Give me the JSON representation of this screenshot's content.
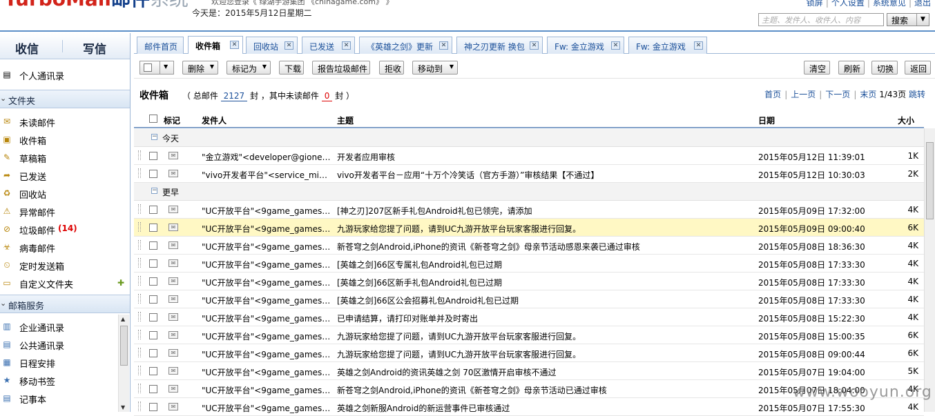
{
  "header": {
    "logo_main": "TurboMail",
    "logo_mail": "邮件",
    "logo_sys": "系统",
    "welcome": "欢迎您登录《 绿湖手游集团   《chinagame.com》 》",
    "today": "今天是：2015年5月12日星期二",
    "links": [
      "锁屏",
      "个人设置",
      "系统意见",
      "退出"
    ],
    "search_placeholder": "主题、发件人、收件人、内容",
    "search_button": "搜索"
  },
  "sidebar": {
    "tab_inbox": "收信",
    "tab_compose": "写信",
    "contacts": "个人通讯录",
    "folders_section": "文件夹",
    "folders": [
      {
        "label": "未读邮件",
        "icon": "unread-folder-icon"
      },
      {
        "label": "收件箱",
        "icon": "inbox-icon"
      },
      {
        "label": "草稿箱",
        "icon": "drafts-icon"
      },
      {
        "label": "已发送",
        "icon": "sent-icon"
      },
      {
        "label": "回收站",
        "icon": "trash-icon"
      },
      {
        "label": "异常邮件",
        "icon": "abnormal-mail-icon"
      },
      {
        "label": "垃圾邮件",
        "icon": "spam-icon"
      },
      {
        "label": "病毒邮件",
        "icon": "virus-mail-icon"
      },
      {
        "label": "定时发送箱",
        "icon": "scheduled-icon"
      },
      {
        "label": "自定义文件夹",
        "icon": "custom-folder-icon"
      }
    ],
    "spam_count": "(14)",
    "services_section": "邮箱服务",
    "services": [
      "企业通讯录",
      "公共通讯录",
      "日程安排",
      "移动书签",
      "记事本"
    ]
  },
  "tabs": [
    "邮件首页",
    "收件箱",
    "回收站",
    "已发送",
    "《英雄之剑》更新",
    "神之刃更新 换包",
    "Fw: 金立游戏",
    "Fw: 金立游戏"
  ],
  "toolbar": {
    "delete": "删除",
    "mark_as": "标记为",
    "download": "下载",
    "report_spam": "报告垃圾邮件",
    "reject": "拒收",
    "move_to": "移动到",
    "clear": "清空",
    "refresh": "刷新",
    "switch": "切换",
    "back": "返回"
  },
  "info": {
    "box_title": "收件箱",
    "total_prefix": "（ 总邮件",
    "total": "2127",
    "mid": "封 ，其中未读邮件",
    "unread": "0",
    "suffix": "封 ）",
    "pager_first": "首页",
    "pager_prev": "上一页",
    "pager_next": "下一页",
    "pager_last": "末页",
    "pager_status": "1/43页",
    "pager_jump": "跳转"
  },
  "columns": {
    "mark": "标记",
    "from": "发件人",
    "subject": "主题",
    "date": "日期",
    "size": "大小"
  },
  "groups": {
    "today": "今天",
    "earlier": "更早"
  },
  "emails_today": [
    {
      "from": "\"金立游戏\"<developer@gionee.com>",
      "subject": "开发者应用审核",
      "date": "2015年05月12日 11:39:01",
      "size": "1K"
    },
    {
      "from": "\"vivo开发者平台\"<service_mi@vivo.com>",
      "subject": "vivo开发者平台－应用“十万个冷笑话（官方手游）”审核结果【不通过】",
      "date": "2015年05月12日 10:30:03",
      "size": "2K"
    }
  ],
  "emails_earlier": [
    {
      "from": "\"UC开放平台\"<9game_gameservice@uc.cn>",
      "subject": "[神之刃]207区新手礼包Android礼包已领完，请添加",
      "date": "2015年05月09日 17:32:00",
      "size": "4K"
    },
    {
      "from": "\"UC开放平台\"<9game_gameservice@uc.cn>",
      "subject": "九游玩家给您提了问题，请到UC九游开放平台玩家客服进行回复。",
      "date": "2015年05月09日 09:00:40",
      "size": "6K"
    },
    {
      "from": "\"UC开放平台\"<9game_gameservice@uc.cn>",
      "subject": "新苍穹之剑Android,iPhone的资讯《新苍穹之剑》母亲节活动感恩来袭已通过审核",
      "date": "2015年05月08日 18:36:30",
      "size": "4K"
    },
    {
      "from": "\"UC开放平台\"<9game_gameservice@uc.cn>",
      "subject": "[英雄之剑]66区专属礼包Android礼包已过期",
      "date": "2015年05月08日 17:33:30",
      "size": "4K"
    },
    {
      "from": "\"UC开放平台\"<9game_gameservice@uc.cn>",
      "subject": "[英雄之剑]66区新手礼包Android礼包已过期",
      "date": "2015年05月08日 17:33:30",
      "size": "4K"
    },
    {
      "from": "\"UC开放平台\"<9game_gameservice@uc.cn>",
      "subject": "[英雄之剑]66区公会招募礼包Android礼包已过期",
      "date": "2015年05月08日 17:33:30",
      "size": "4K"
    },
    {
      "from": "\"UC开放平台\"<9game_gameservice@uc.cn>",
      "subject": "已申请结算，请打印对账单并及时寄出",
      "date": "2015年05月08日 15:22:30",
      "size": "4K"
    },
    {
      "from": "\"UC开放平台\"<9game_gameservice@uc.cn>",
      "subject": "九游玩家给您提了问题，请到UC九游开放平台玩家客服进行回复。",
      "date": "2015年05月08日 15:00:35",
      "size": "6K"
    },
    {
      "from": "\"UC开放平台\"<9game_gameservice@uc.cn>",
      "subject": "九游玩家给您提了问题，请到UC九游开放平台玩家客服进行回复。",
      "date": "2015年05月08日 09:00:44",
      "size": "6K"
    },
    {
      "from": "\"UC开放平台\"<9game_gameservice@uc.cn>",
      "subject": "英雄之剑Android的资讯英雄之剑 70区激情开启审核不通过",
      "date": "2015年05月07日 19:04:00",
      "size": "5K"
    },
    {
      "from": "\"UC开放平台\"<9game_gameservice@uc.cn>",
      "subject": "新苍穹之剑Android,iPhone的资讯《新苍穹之剑》母亲节活动已通过审核",
      "date": "2015年05月07日 18:04:00",
      "size": "4K"
    },
    {
      "from": "\"UC开放平台\"<9game_gameservice@uc.cn>",
      "subject": "英雄之剑新服Android的新运营事件已审核通过",
      "date": "2015年05月07日 17:55:30",
      "size": "4K"
    }
  ],
  "watermark": "www.wooyun.org",
  "colors": {
    "accent": "#1a4f99",
    "highlight_row": "#fff8c4",
    "logo_red": "#d2231a",
    "unread_red": "#dd0000"
  }
}
